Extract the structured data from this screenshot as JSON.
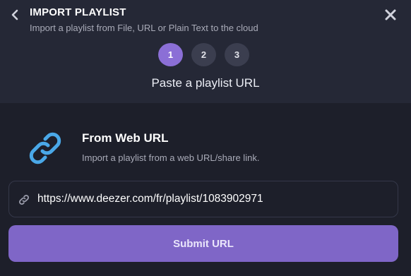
{
  "header": {
    "title": "IMPORT PLAYLIST",
    "subtitle": "Import a playlist from File, URL or Plain Text to the cloud",
    "back_icon": "chevron-left-icon",
    "close_icon": "close-icon"
  },
  "steps": {
    "items": [
      {
        "label": "1",
        "active": true
      },
      {
        "label": "2",
        "active": false
      },
      {
        "label": "3",
        "active": false
      }
    ],
    "current_title": "Paste a playlist URL"
  },
  "source": {
    "icon": "link-icon",
    "title": "From Web URL",
    "description": "Import a playlist from a web URL/share link."
  },
  "url_field": {
    "icon": "link-icon",
    "value": "https://www.deezer.com/fr/playlist/1083902971"
  },
  "submit": {
    "label": "Submit URL"
  },
  "colors": {
    "accent": "#8b6fd6",
    "button": "#7f66c7",
    "link_icon": "#4aa8e8",
    "background": "#1d1f2a",
    "header_background": "#252836"
  }
}
